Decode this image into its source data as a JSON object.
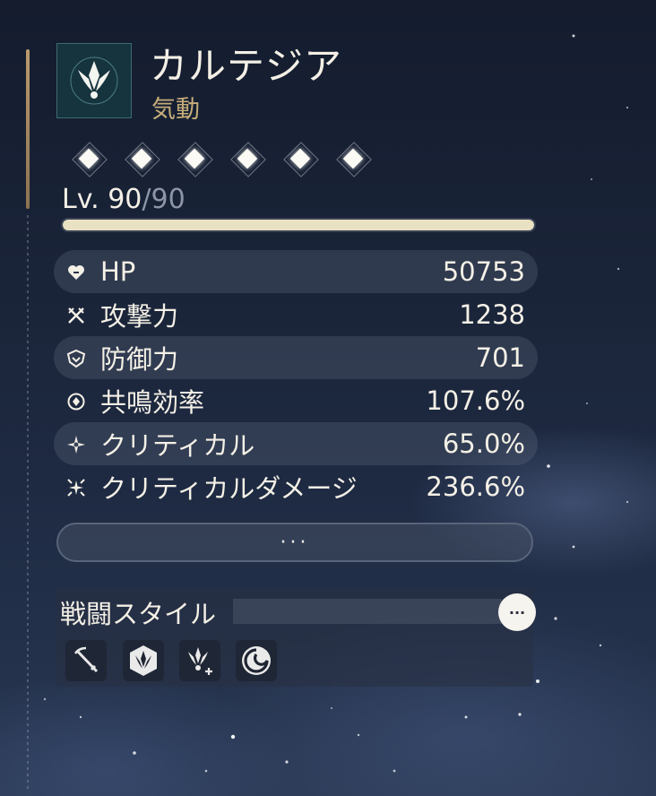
{
  "character": {
    "name": "カルテジア",
    "attribute": "気動"
  },
  "level": {
    "label": "Lv. ",
    "current": "90",
    "separator": "/",
    "max": "90"
  },
  "stats": [
    {
      "icon": "heart-icon",
      "label": "HP",
      "value": "50753"
    },
    {
      "icon": "crossed-swords-icon",
      "label": "攻撃力",
      "value": "1238"
    },
    {
      "icon": "shield-icon",
      "label": "防御力",
      "value": "701"
    },
    {
      "icon": "resonance-icon",
      "label": "共鳴効率",
      "value": "107.6%"
    },
    {
      "icon": "crit-star-icon",
      "label": "クリティカル",
      "value": "65.0%"
    },
    {
      "icon": "crit-damage-icon",
      "label": "クリティカルダメージ",
      "value": "236.6%"
    }
  ],
  "more_label": "···",
  "combat_style": {
    "title": "戦闘スタイル",
    "more_label": "···",
    "icons": [
      "sword-slash-icon",
      "emblem-hex-icon",
      "emblem-plus-icon",
      "swirl-icon"
    ]
  },
  "colors": {
    "accent": "#c6ad79",
    "level_bar": "#e9e2c2",
    "text": "#f4f0e6"
  }
}
